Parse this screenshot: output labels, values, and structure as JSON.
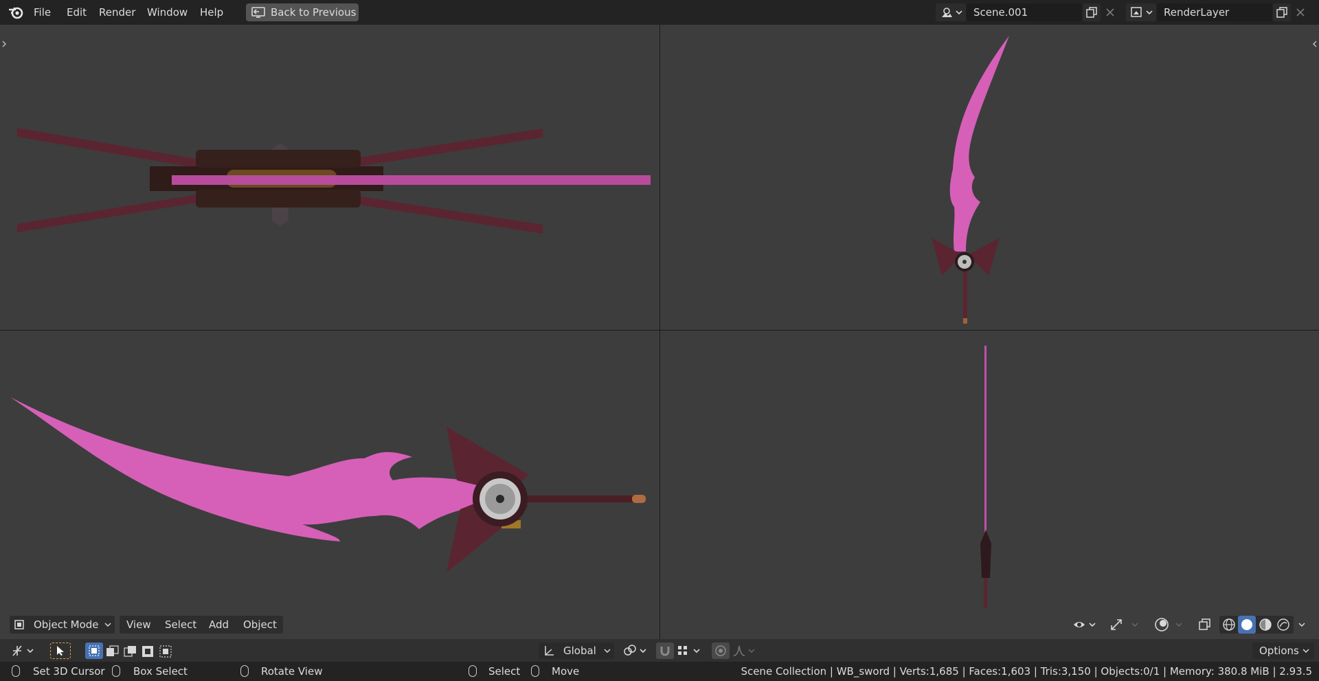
{
  "menu": {
    "items": [
      "File",
      "Edit",
      "Render",
      "Window",
      "Help"
    ],
    "back_label": "Back to Previous"
  },
  "scene": {
    "name": "Scene.001"
  },
  "render_layer": {
    "name": "RenderLayer"
  },
  "viewport_header": {
    "mode_label": "Object Mode",
    "menus": [
      "View",
      "Select",
      "Add",
      "Object"
    ]
  },
  "toolbar": {
    "orientation_label": "Global",
    "options_label": "Options"
  },
  "status": {
    "hint_set_cursor": "Set 3D Cursor",
    "hint_box_select": "Box Select",
    "hint_rotate": "Rotate View",
    "hint_select": "Select",
    "hint_move": "Move",
    "info": "Scene Collection | WB_sword | Verts:1,685 | Faces:1,603 | Tris:3,150 | Objects:0/1 | Memory: 380.8 MiB | 2.93.5"
  },
  "colors": {
    "blade": "#d660b8",
    "guard": "#5a2530",
    "background": "#3d3d3d"
  }
}
